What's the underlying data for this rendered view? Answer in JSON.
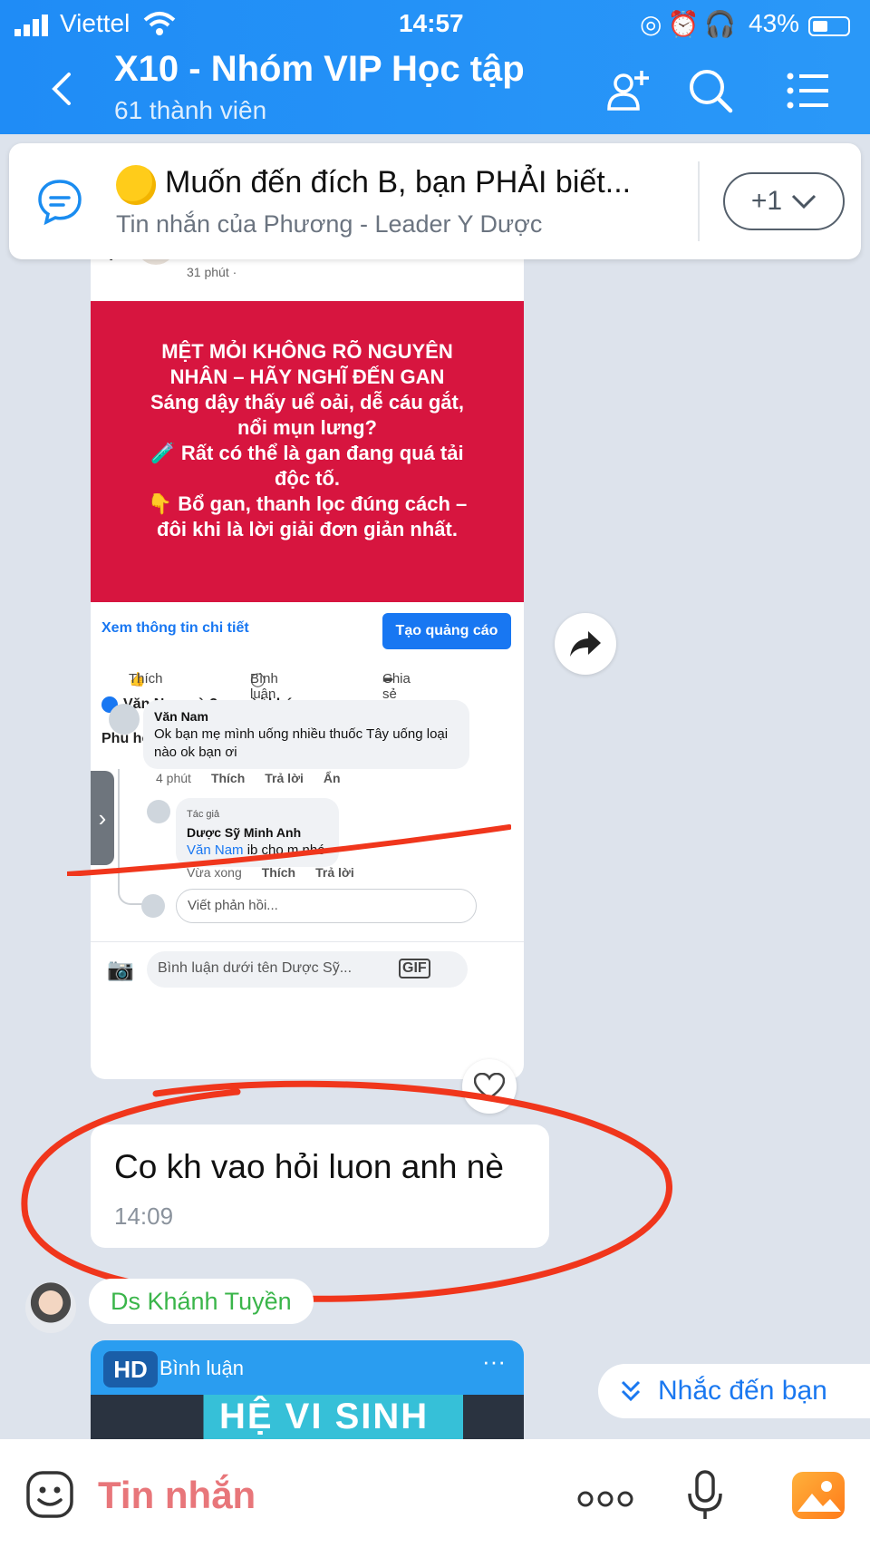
{
  "status_bar": {
    "carrier": "Viettel",
    "time": "14:57",
    "battery": "43%"
  },
  "header": {
    "title": "X10 - Nhóm VIP Học tập",
    "subtitle": "61 thành viên",
    "icons": [
      "back-icon",
      "add-member-icon",
      "search-icon",
      "menu-icon"
    ]
  },
  "pinned": {
    "message": "Muốn đến đích B, bạn PHẢI biết...",
    "from": "Tin nhắn của Phương - Leader Y Dược",
    "more_label": "+1"
  },
  "fb_post": {
    "time": "31 phút ·",
    "banner_lines": [
      "MỆT MỎI KHÔNG RÕ NGUYÊN",
      "NHÂN – HÃY NGHĨ ĐẾN GAN",
      "Sáng dậy thấy uể oải, dễ cáu gắt,",
      "nổi mụn lưng?",
      "🧪 Rất có thể là gan đang quá tải",
      "độc tố.",
      "👇 Bổ gan, thanh lọc đúng cách –",
      "đôi khi là lời giải đơn giản nhất."
    ],
    "detail_link": "Xem thông tin chi tiết",
    "ad_button": "Tạo quảng cáo",
    "actions": {
      "like": "Thích",
      "comment": "Bình luận",
      "share": "Chia sẻ"
    },
    "likes_text": "Văn Nam và 2 người khác",
    "sort_label": "Phù hợp nhất ⌄",
    "comment1": {
      "author": "Văn Nam",
      "text": "Ok bạn mẹ mình uống nhiều thuốc Tây uống loại nào ok bạn ơi",
      "time": "4 phút",
      "like": "Thích",
      "reply": "Trả lời",
      "hide": "Ẩn"
    },
    "comment2": {
      "badge": "Tác giả",
      "author": "Dược Sỹ Minh Anh",
      "mention": "Văn Nam",
      "text": " ib cho m nhé",
      "time": "Vừa xong",
      "like": "Thích",
      "reply": "Trả lời"
    },
    "reply_placeholder": "Viết phản hồi...",
    "comment_placeholder": "Bình luận dưới tên Dược Sỹ...",
    "gif_label": "GIF"
  },
  "message": {
    "text": "Co kh vao hỏi luon anh nè",
    "time": "14:09"
  },
  "next_sender": "Ds Khánh Tuyền",
  "card2": {
    "badge": "HD",
    "label": "Bình luận",
    "menu": "···",
    "art_text": "HỆ VI SINH"
  },
  "mention_chip": "Nhắc đến bạn",
  "composer": {
    "placeholder": "Tin nhắn",
    "more": "ooo"
  },
  "colors": {
    "header_blue": "#1f8cf6",
    "banner_red": "#d7153f",
    "annotation_red": "#f0361c",
    "sender_green": "#3ab54a",
    "placeholder_pink": "#e8767a"
  }
}
